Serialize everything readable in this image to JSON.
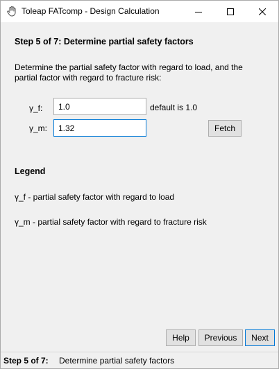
{
  "window": {
    "title": "Toleap FATcomp - Design Calculation",
    "icon": "hand-icon",
    "controls": [
      "minimize-icon",
      "maximize-icon",
      "close-icon"
    ]
  },
  "step": {
    "heading": "Step 5 of 7: Determine partial safety factors",
    "description": "Determine the partial safety factor with regard to load, and the partial factor with regard to fracture risk:"
  },
  "form": {
    "gamma_f": {
      "label": "γ_f:",
      "value": "1.0",
      "hint": "default is 1.0"
    },
    "gamma_m": {
      "label": "γ_m:",
      "value": "1.32"
    },
    "fetch_label": "Fetch"
  },
  "legend": {
    "title": "Legend",
    "items": [
      "γ_f - partial safety factor with regard to load",
      "γ_m - partial safety factor with regard to fracture risk"
    ]
  },
  "nav": {
    "help_label": "Help",
    "previous_label": "Previous",
    "next_label": "Next"
  },
  "status": {
    "step_label": "Step 5 of 7:",
    "text": "Determine partial safety factors"
  },
  "colors": {
    "window_bg": "#f0f0f0",
    "focus_border": "#0078d7",
    "button_bg": "#e1e1e1"
  }
}
